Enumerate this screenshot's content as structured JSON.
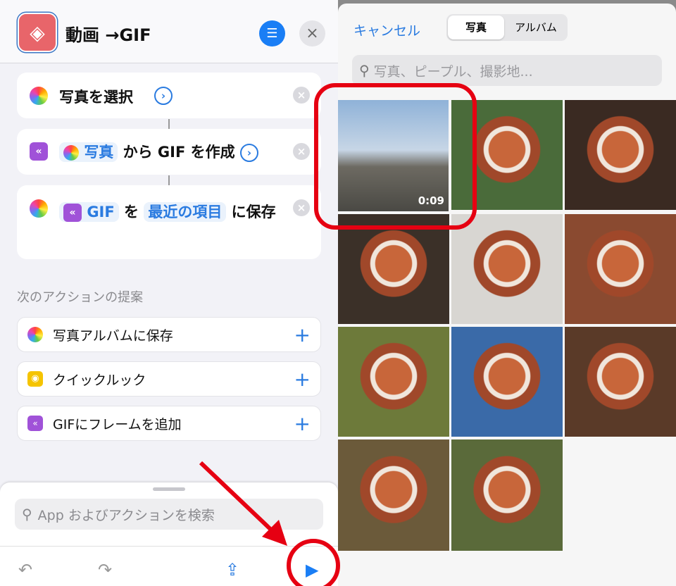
{
  "shortcut": {
    "title": "動画 →GIF",
    "close_icon": "×"
  },
  "actions": [
    {
      "text": "写真を選択"
    },
    {
      "token": "写真",
      "text": "から GIF を作成"
    },
    {
      "token1": "GIF",
      "mid": "を",
      "token2": "最近の項目",
      "tail": "に保存"
    }
  ],
  "suggestions": {
    "heading": "次のアクションの提案",
    "items": [
      {
        "label": "写真アルバムに保存",
        "icon": "photos-icon"
      },
      {
        "label": "クイックルック",
        "icon": "quicklook-icon"
      },
      {
        "label": "GIFにフレームを追加",
        "icon": "gif-icon"
      }
    ]
  },
  "search": {
    "placeholder": "App およびアクションを検索"
  },
  "picker": {
    "cancel": "キャンセル",
    "tabs": [
      "写真",
      "アルバム"
    ],
    "selected_tab": "写真",
    "search_placeholder": "写真、ピープル、撮影地...",
    "video_duration": "0:09"
  },
  "colors": {
    "accent": "#2a7be0",
    "highlight": "#e60012"
  }
}
